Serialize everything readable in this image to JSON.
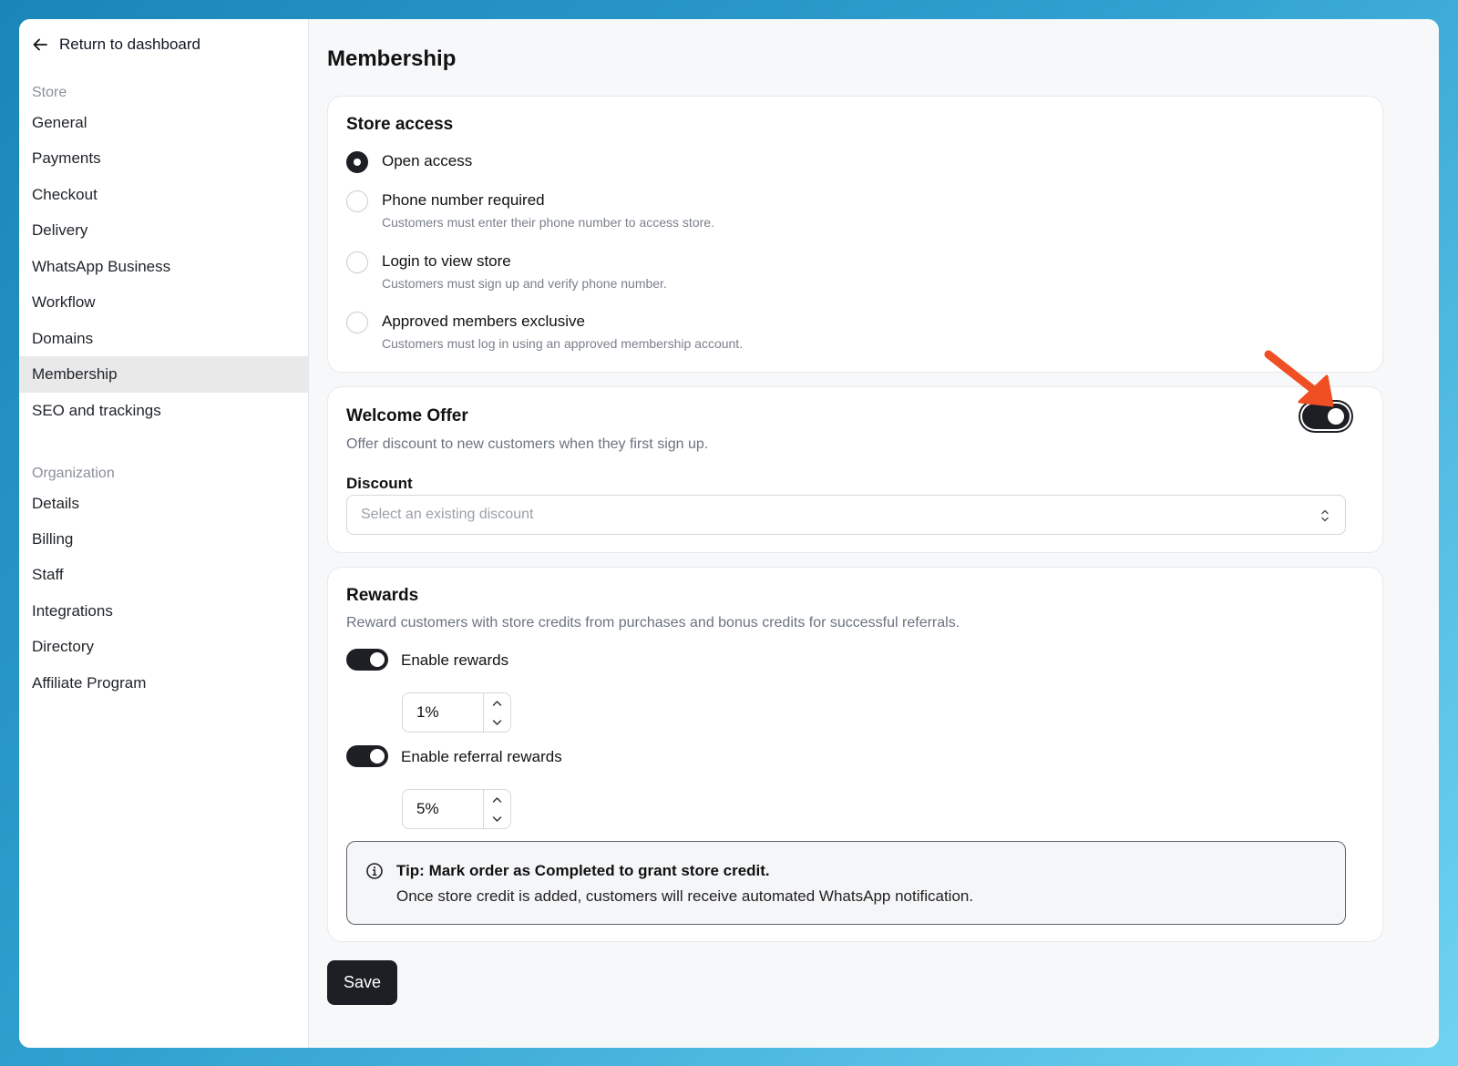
{
  "sidebar": {
    "back_label": "Return to dashboard",
    "store_section": "Store",
    "store_items": [
      "General",
      "Payments",
      "Checkout",
      "Delivery",
      "WhatsApp Business",
      "Workflow",
      "Domains",
      "Membership",
      "SEO and trackings"
    ],
    "active_item": "Membership",
    "org_section": "Organization",
    "org_items": [
      "Details",
      "Billing",
      "Staff",
      "Integrations",
      "Directory",
      "Affiliate Program"
    ]
  },
  "page": {
    "title": "Membership"
  },
  "store_access": {
    "title": "Store access",
    "options": [
      {
        "label": "Open access",
        "help": "",
        "checked": true
      },
      {
        "label": "Phone number required",
        "help": "Customers must enter their phone number to access store.",
        "checked": false
      },
      {
        "label": "Login to view store",
        "help": "Customers must sign up and verify phone number.",
        "checked": false
      },
      {
        "label": "Approved members exclusive",
        "help": "Customers must log in using an approved membership account.",
        "checked": false
      }
    ]
  },
  "welcome_offer": {
    "title": "Welcome Offer",
    "description": "Offer discount to new customers when they first sign up.",
    "enabled": true,
    "discount_label": "Discount",
    "discount_placeholder": "Select an existing discount"
  },
  "rewards": {
    "title": "Rewards",
    "description": "Reward customers with store credits from purchases and bonus credits for successful referrals.",
    "enable_rewards_label": "Enable rewards",
    "enable_rewards": true,
    "rewards_value": "1%",
    "enable_referral_label": "Enable referral rewards",
    "enable_referral": true,
    "referral_value": "5%",
    "tip_title": "Tip: Mark order as Completed to grant store credit.",
    "tip_body": "Once store credit is added, customers will receive automated WhatsApp notification."
  },
  "actions": {
    "save_label": "Save"
  },
  "colors": {
    "accent": "#1d1f24",
    "annotation_arrow": "#f04e23"
  }
}
